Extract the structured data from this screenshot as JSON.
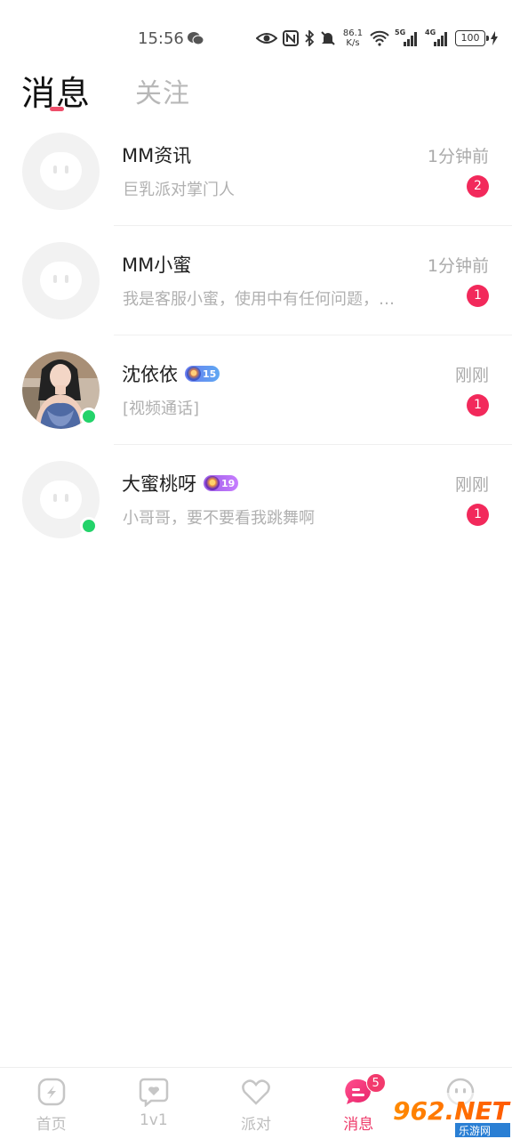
{
  "status_bar": {
    "time": "15:56",
    "net_speed_value": "86.1",
    "net_speed_unit": "K/s",
    "signal_5g": "5G",
    "signal_4g": "4G",
    "battery": "100"
  },
  "header": {
    "tab_messages": "消息",
    "tab_follow": "关注"
  },
  "conversations": [
    {
      "name": "MM资讯",
      "time": "1分钟前",
      "preview": "巨乳派对掌门人",
      "unread": "2",
      "online": false,
      "level": null
    },
    {
      "name": "MM小蜜",
      "time": "1分钟前",
      "preview": "我是客服小蜜，使用中有任何问题，请联系我",
      "unread": "1",
      "online": false,
      "level": null
    },
    {
      "name": "沈依依",
      "time": "刚刚",
      "preview": "[视频通话]",
      "unread": "1",
      "online": true,
      "level": "15"
    },
    {
      "name": "大蜜桃呀",
      "time": "刚刚",
      "preview": "小哥哥，要不要看我跳舞啊",
      "unread": "1",
      "online": true,
      "level": "19"
    }
  ],
  "bottom_nav": {
    "home": "首页",
    "one_on_one": "1v1",
    "party": "派对",
    "messages": "消息",
    "messages_badge": "5"
  },
  "watermark": {
    "brand": "962.NET",
    "caption": "乐游网"
  },
  "colors": {
    "accent": "#ee3b6a",
    "unread": "#f2295b",
    "online": "#23d36a"
  }
}
